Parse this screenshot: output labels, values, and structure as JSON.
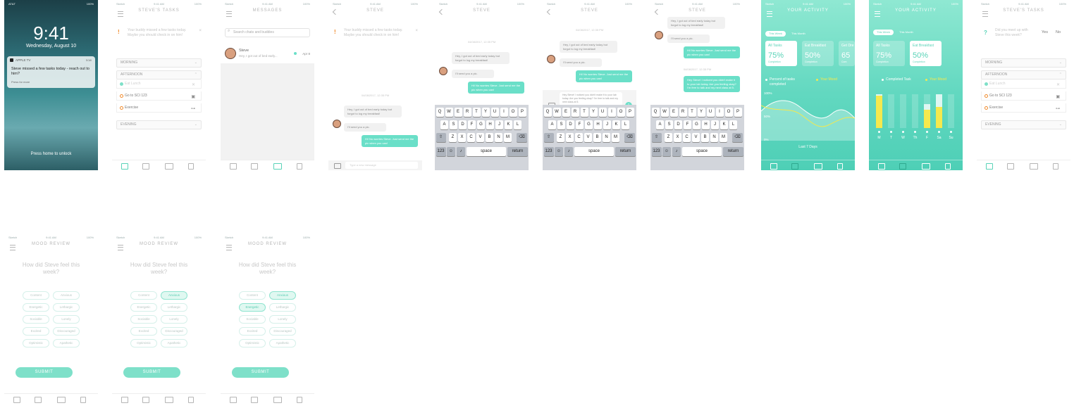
{
  "lock": {
    "status_left": "AT&T",
    "status_right": "100%",
    "time": "9:41",
    "date": "Wednesday, August 10",
    "notif_app": "APPLE TV",
    "notif_time": "now",
    "notif_body": "Steve missed a few tasks today - reach out to him?",
    "notif_hint": "Press for more",
    "unlock": "Press home to unlock"
  },
  "status": {
    "carrier": "Sketch",
    "time": "9:41 AM",
    "battery": "100%"
  },
  "tasks": {
    "title": "STEVE'S TASKS",
    "banner": "Your buddy missed a few tasks today. Maybe you should check in on him!",
    "close": "×",
    "morning": "MORNING",
    "afternoon": "AFTERNOON",
    "evening": "EVENING",
    "items": [
      "Eat Lunch",
      "Go to SCI 123",
      "Exercise"
    ]
  },
  "messages": {
    "title": "MESSAGES",
    "search_placeholder": "Search chats and buddies",
    "contact": "Steve",
    "preview": "Hey, I got out of bed early...",
    "date": "Apr 8"
  },
  "chat": {
    "title": "STEVE",
    "ts1": "04/08/2017, 12:35 PM",
    "ts2": "04/08/2017, 12:35 PM",
    "msg1": "Hey, I got out of bed early today but forgot to log my breakfast!",
    "msg2": "I'll send you a pic.",
    "reply1": "Hi! No worries Steve. Just send me the pic when you can!",
    "reply2": "Hey Steve! I noticed you didn't make it to your lab today. Are you feeling okay? I'm free to talk and my next class at 5.",
    "placeholder": "Type a new message",
    "banner": "Your buddy missed a few tasks today. Maybe you should check in on him!"
  },
  "keyboard": {
    "row1": [
      "Q",
      "W",
      "E",
      "R",
      "T",
      "Y",
      "U",
      "I",
      "O",
      "P"
    ],
    "row2": [
      "A",
      "S",
      "D",
      "F",
      "G",
      "H",
      "J",
      "K",
      "L"
    ],
    "row3": [
      "Z",
      "X",
      "C",
      "V",
      "B",
      "N",
      "M"
    ],
    "num": "123",
    "space": "space",
    "ret": "return"
  },
  "activity": {
    "title": "YOUR ACTIVITY",
    "week": "This Week",
    "month": "This Month",
    "cards": [
      {
        "t": "All Tasks",
        "v": "75%",
        "s": "Completion"
      },
      {
        "t": "Eat Breakfast",
        "v": "50%",
        "s": "Completion"
      },
      {
        "t": "Get Dre",
        "v": "65",
        "s": "Com"
      }
    ],
    "legend_a": "Percent of tasks completed",
    "legend_b": "Your Mood",
    "legend_c": "Completed Task",
    "legend_d": "Your Mood",
    "y100": "100%",
    "y50": "50%",
    "y0": "0%",
    "range": "Last 7 Days",
    "days": [
      "M",
      "T",
      "W",
      "Th",
      "F",
      "Sa",
      "Su"
    ]
  },
  "meetup": {
    "question": "Did you meet up with Steve this week?",
    "yes": "Yes",
    "no": "No"
  },
  "mood": {
    "title": "MOOD REVIEW",
    "question": "How did Steve feel this week?",
    "options": [
      "Content",
      "Anxious",
      "Energetic",
      "Lethargic",
      "Sociable",
      "Lonely",
      "Excited",
      "Discouraged",
      "Optimistic",
      "Apathetic"
    ],
    "submit": "SUBMIT"
  },
  "colors": {
    "mint": "#6adfc8",
    "orange": "#f08a2b",
    "yellow": "#f5e94d"
  }
}
